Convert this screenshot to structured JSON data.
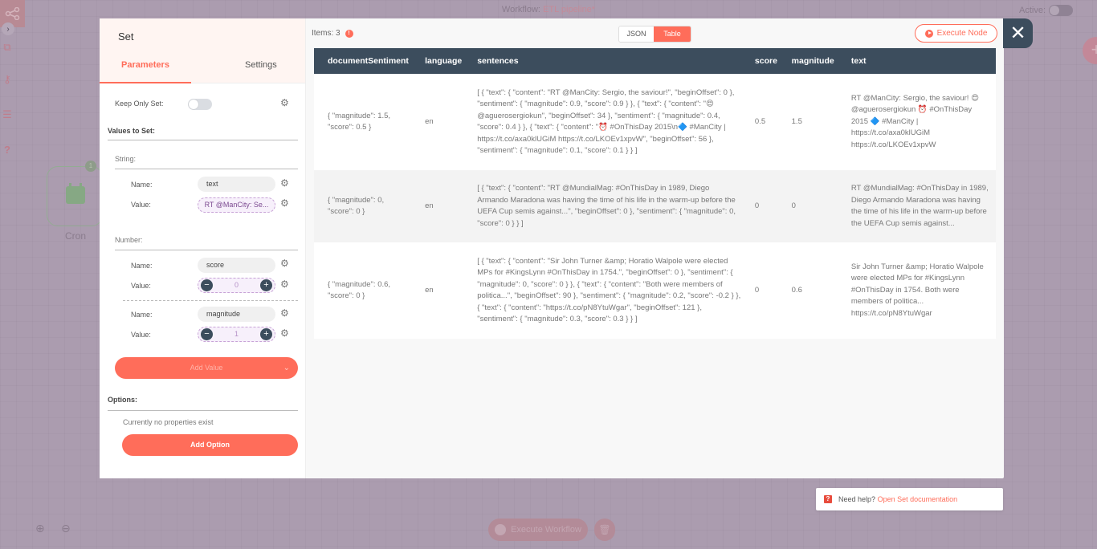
{
  "workflow": {
    "title_prefix": "Workflow:",
    "name": "ETL pipeline*",
    "active_label": "Active:"
  },
  "canvas": {
    "node_label": "Cron",
    "node_badge": "1",
    "execute_workflow_label": "Execute Workflow"
  },
  "sidebar": {
    "icons": [
      "workflow-logo-icon",
      "expand-chevron-icon",
      "network-icon",
      "key-icon",
      "list-icon",
      "help-icon"
    ]
  },
  "node_panel": {
    "title": "Set",
    "tabs": [
      {
        "label": "Parameters",
        "active": true
      },
      {
        "label": "Settings",
        "active": false
      }
    ],
    "keep_only_set_label": "Keep Only Set:",
    "keep_only_set_value": false,
    "values_to_set_label": "Values to Set:",
    "string_section_label": "String:",
    "number_section_label": "Number:",
    "name_label": "Name:",
    "value_label": "Value:",
    "string_values": [
      {
        "name": "text",
        "value": "RT @ManCity: Se..."
      }
    ],
    "number_values": [
      {
        "name": "score",
        "value": "0"
      },
      {
        "name": "magnitude",
        "value": "1"
      }
    ],
    "add_value_label": "Add Value",
    "options_label": "Options:",
    "no_properties_text": "Currently no properties exist",
    "add_option_label": "Add Option"
  },
  "output": {
    "items_label": "Items: 3",
    "views": [
      {
        "label": "JSON",
        "active": false
      },
      {
        "label": "Table",
        "active": true
      }
    ],
    "execute_node_label": "Execute Node",
    "columns": [
      "documentSentiment",
      "language",
      "sentences",
      "score",
      "magnitude",
      "text"
    ],
    "rows": [
      {
        "documentSentiment": "{ \"magnitude\": 1.5, \"score\": 0.5 }",
        "language": "en",
        "sentences": "[ { \"text\": { \"content\": \"RT @ManCity: Sergio, the saviour!\", \"beginOffset\": 0 }, \"sentiment\": { \"magnitude\": 0.9, \"score\": 0.9 } }, { \"text\": { \"content\": \"😍 @aguerosergiokun\", \"beginOffset\": 34 }, \"sentiment\": { \"magnitude\": 0.4, \"score\": 0.4 } }, { \"text\": { \"content\": \"⏰ #OnThisDay 2015\\n🔷 #ManCity | https://t.co/axa0klUGiM https://t.co/LKOEv1xpvW\", \"beginOffset\": 56 }, \"sentiment\": { \"magnitude\": 0.1, \"score\": 0.1 } } ]",
        "score": "0.5",
        "magnitude": "1.5",
        "text": "RT @ManCity: Sergio, the saviour! 😍 @aguerosergiokun ⏰ #OnThisDay 2015 🔷 #ManCity | https://t.co/axa0klUGiM https://t.co/LKOEv1xpvW"
      },
      {
        "documentSentiment": "{ \"magnitude\": 0, \"score\": 0 }",
        "language": "en",
        "sentences": "[ { \"text\": { \"content\": \"RT @MundialMag: #OnThisDay in 1989, Diego Armando Maradona was having the time of his life in the warm-up before the UEFA Cup semis against...\", \"beginOffset\": 0 }, \"sentiment\": { \"magnitude\": 0, \"score\": 0 } } ]",
        "score": "0",
        "magnitude": "0",
        "text": "RT @MundialMag: #OnThisDay in 1989, Diego Armando Maradona was having the time of his life in the warm-up before the UEFA Cup semis against..."
      },
      {
        "documentSentiment": "{ \"magnitude\": 0.6, \"score\": 0 }",
        "language": "en",
        "sentences": "[ { \"text\": { \"content\": \"Sir John Turner &amp; Horatio Walpole were elected MPs for #KingsLynn #OnThisDay in 1754.\", \"beginOffset\": 0 }, \"sentiment\": { \"magnitude\": 0, \"score\": 0 } }, { \"text\": { \"content\": \"Both were members of politica...\", \"beginOffset\": 90 }, \"sentiment\": { \"magnitude\": 0.2, \"score\": -0.2 } }, { \"text\": { \"content\": \"https://t.co/pN8YtuWgar\", \"beginOffset\": 121 }, \"sentiment\": { \"magnitude\": 0.3, \"score\": 0.3 } } ]",
        "score": "0",
        "magnitude": "0.6",
        "text": "Sir John Turner &amp; Horatio Walpole were elected MPs for #KingsLynn #OnThisDay in 1754. Both were members of politica... https://t.co/pN8YtuWgar"
      }
    ]
  },
  "help": {
    "prefix": "Need help?",
    "link_label": "Open Set documentation"
  },
  "colors": {
    "accent": "#ff6d5a",
    "dark": "#3c4d5d",
    "overlay": "#ab9caf"
  }
}
